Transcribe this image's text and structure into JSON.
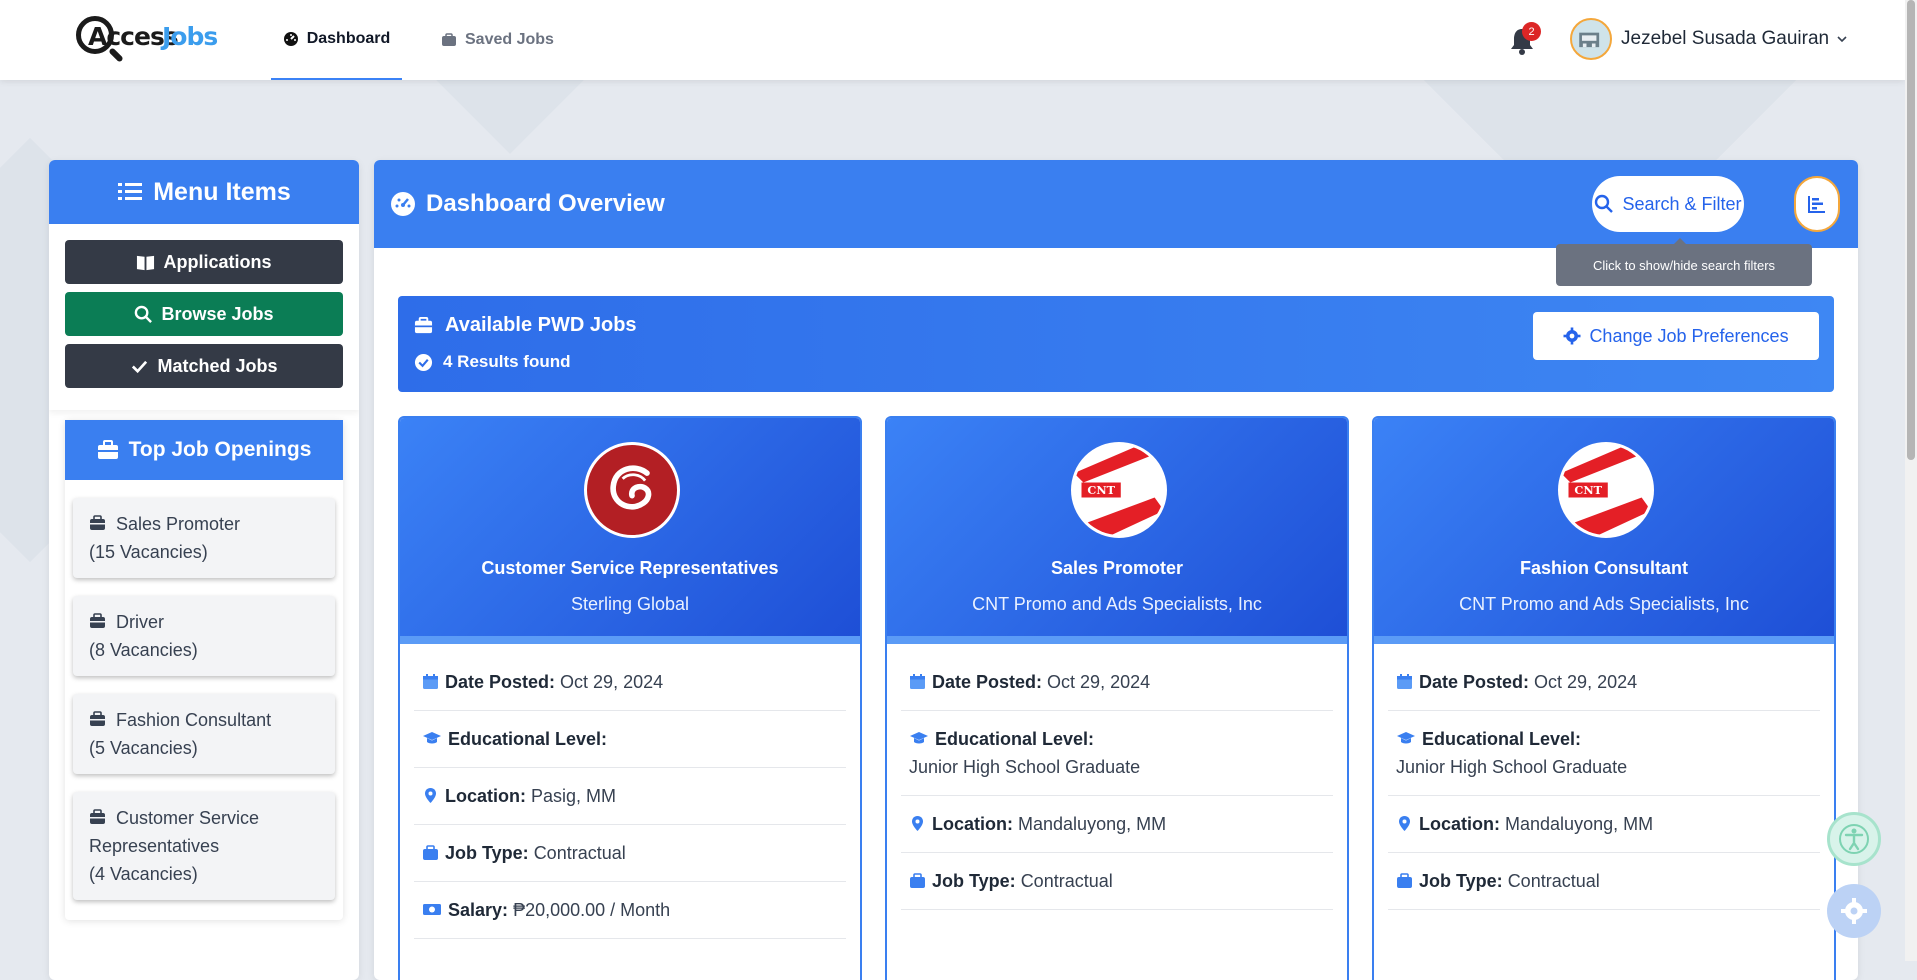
{
  "brand": {
    "logo_part1": "Access",
    "logo_part2": "Jobs"
  },
  "nav": {
    "tabs": [
      {
        "label": "Dashboard",
        "icon": "dashboard-icon",
        "active": true
      },
      {
        "label": "Saved Jobs",
        "icon": "briefcase-icon",
        "active": false
      }
    ],
    "notifications_count": "2",
    "username": "Jezebel Susada Gauiran"
  },
  "sidebar": {
    "menu_title": "Menu Items",
    "menu_buttons": [
      {
        "label": "Applications",
        "icon": "book-icon",
        "color": "#343a46"
      },
      {
        "label": "Browse Jobs",
        "icon": "search-icon",
        "color": "#0b7d55"
      },
      {
        "label": "Matched Jobs",
        "icon": "check-icon",
        "color": "#343a46"
      }
    ],
    "top_openings_title": "Top Job Openings",
    "top_openings": [
      {
        "title": "Sales Promoter",
        "vacancies": "(15 Vacancies)"
      },
      {
        "title": "Driver",
        "vacancies": "(8 Vacancies)"
      },
      {
        "title": "Fashion Consultant",
        "vacancies": "(5 Vacancies)"
      },
      {
        "title": "Customer Service Representatives",
        "vacancies": "(4 Vacancies)"
      }
    ]
  },
  "main": {
    "title": "Dashboard Overview",
    "search_button": "Search & Filter",
    "tooltip": "Click to show/hide search filters",
    "banner_title": "Available PWD Jobs",
    "results": "4 Results found",
    "preferences_button": "Change Job Preferences",
    "labels": {
      "date_posted": "Date Posted:",
      "education": "Educational Level:",
      "location": "Location:",
      "job_type": "Job Type:",
      "salary": "Salary:"
    },
    "jobs": [
      {
        "title": "Customer Service Representatives",
        "company": "Sterling Global",
        "date_posted": "Oct 29, 2024",
        "education": "",
        "location": "Pasig, MM",
        "job_type": "Contractual",
        "salary": "₱20,000.00 / Month"
      },
      {
        "title": "Sales Promoter",
        "company": "CNT Promo and Ads Specialists, Inc",
        "date_posted": "Oct 29, 2024",
        "education": "Junior High School Graduate",
        "location": "Mandaluyong, MM",
        "job_type": "Contractual"
      },
      {
        "title": "Fashion Consultant",
        "company": "CNT Promo and Ads Specialists, Inc",
        "date_posted": "Oct 29, 2024",
        "education": "Junior High School Graduate",
        "location": "Mandaluyong, MM",
        "job_type": "Contractual"
      }
    ]
  },
  "colors": {
    "primary": "#3a7ff0",
    "dark_button": "#343a46",
    "green_button": "#0b7d55",
    "accent_orange": "#f4a73b",
    "badge_red": "#dc2626"
  }
}
